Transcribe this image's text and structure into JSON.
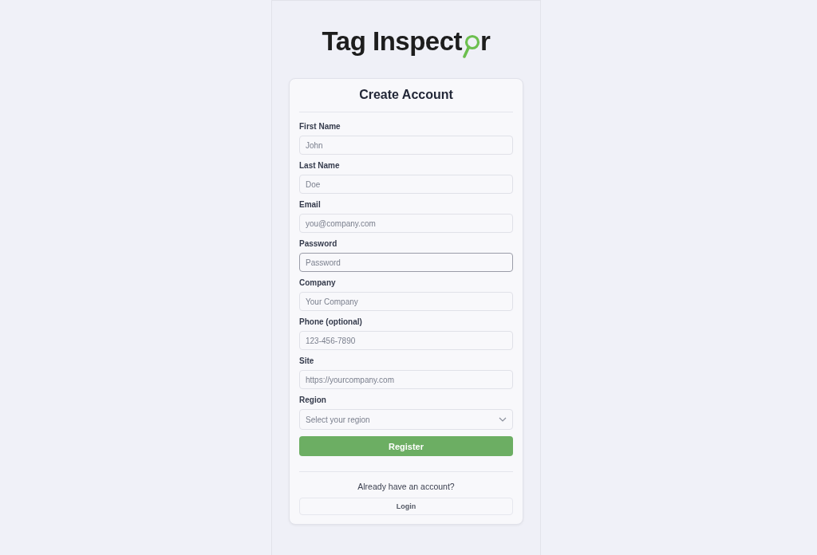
{
  "logo": {
    "before": "Tag Inspect",
    "after": "r"
  },
  "form": {
    "title": "Create Account",
    "fields": [
      {
        "kind": "input",
        "label": "First Name",
        "placeholder": "John",
        "focused": false
      },
      {
        "kind": "input",
        "label": "Last Name",
        "placeholder": "Doe",
        "focused": false
      },
      {
        "kind": "input",
        "label": "Email",
        "placeholder": "you@company.com",
        "focused": false
      },
      {
        "kind": "input",
        "label": "Password",
        "placeholder": "Password",
        "focused": true
      },
      {
        "kind": "input",
        "label": "Company",
        "placeholder": "Your Company",
        "focused": false
      },
      {
        "kind": "input",
        "label": "Phone (optional)",
        "placeholder": "123-456-7890",
        "focused": false
      },
      {
        "kind": "input",
        "label": "Site",
        "placeholder": "https://yourcompany.com",
        "focused": false
      },
      {
        "kind": "select",
        "label": "Region",
        "placeholder": "Select your region",
        "focused": false
      }
    ],
    "submit": "Register",
    "prompt": "Already have an account?",
    "login": "Login"
  }
}
